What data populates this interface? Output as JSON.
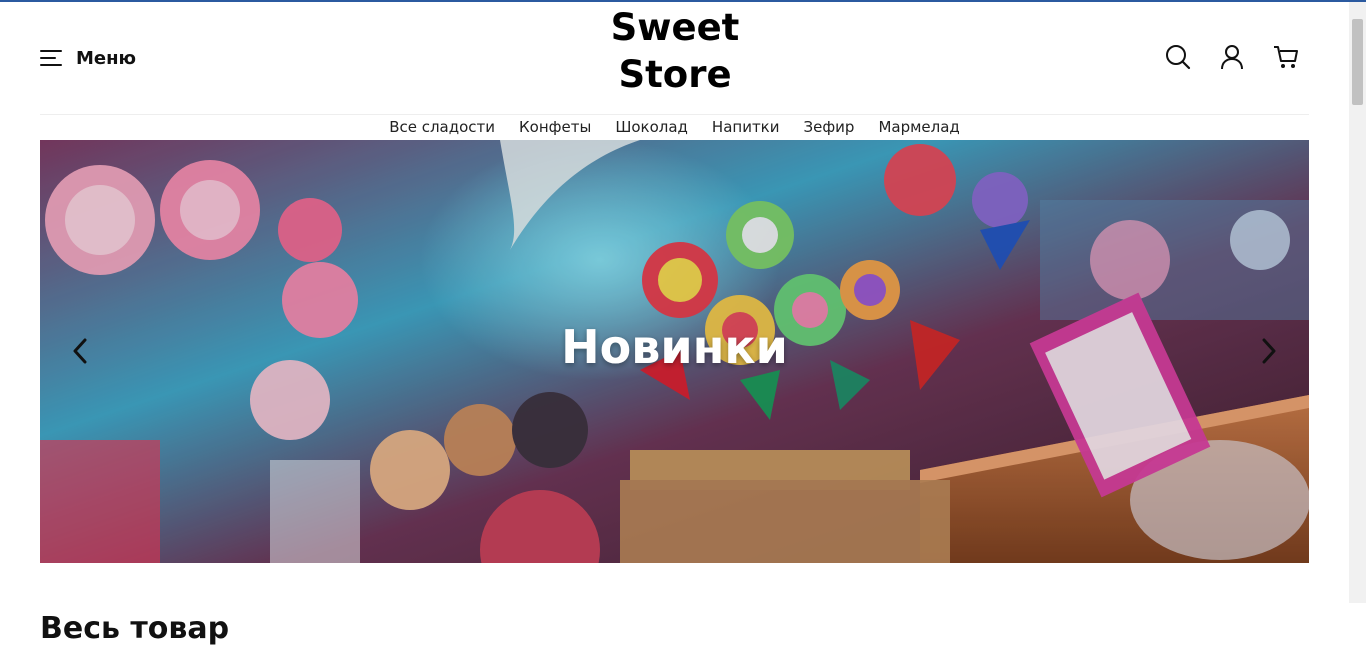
{
  "header": {
    "menu_label": "Меню",
    "logo_line1": "Sweet",
    "logo_line2": "Store",
    "icons": [
      "search-icon",
      "user-icon",
      "cart-icon"
    ]
  },
  "nav": {
    "items": [
      "Все сладости",
      "Конфеты",
      "Шоколад",
      "Напитки",
      "Зефир",
      "Мармелад"
    ]
  },
  "slider": {
    "title": "Новинки",
    "arrows": [
      "chevron-left-icon",
      "chevron-right-icon"
    ]
  },
  "section": {
    "title": "Весь товар"
  },
  "colors": {
    "accent_top_line": "#2b5aa0",
    "text": "#111111"
  }
}
